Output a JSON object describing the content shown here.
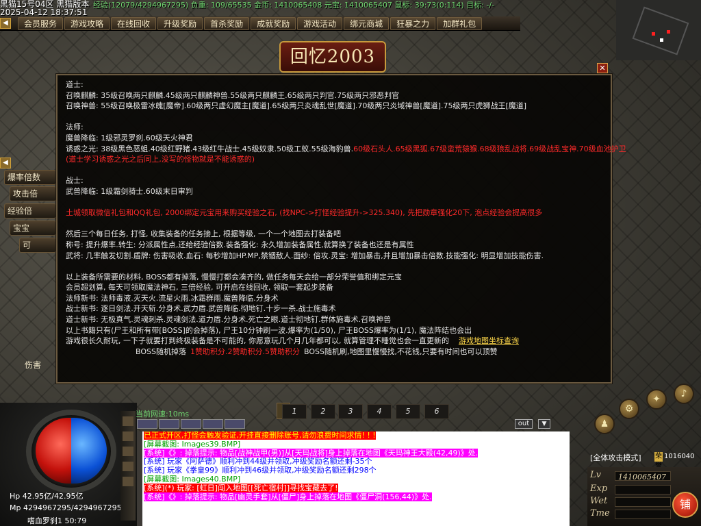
{
  "title_bar": {
    "line1": "黑猫15号04区 黑猫版本",
    "line2": "2025-04-12 18:37:51",
    "status": "经验(12079/4294967295) 负重: 109/65535 金币: 1410065408 元宝: 1410065407 鼠标: 39:73(0:114) 目标: -/-"
  },
  "menu": [
    "会员服务",
    "游戏攻略",
    "在线回收",
    "升级奖励",
    "首杀奖励",
    "成就奖励",
    "游戏活动",
    "绑元商城",
    "狂暴之力",
    "加群礼包"
  ],
  "banner": "回忆2003",
  "side_buttons": [
    "爆率倍数",
    "攻击倍",
    "经验倍",
    "宝宝",
    "可",
    "伤害"
  ],
  "panel_lines": [
    {
      "t": "道士:"
    },
    {
      "t": "召唤麒麟:  35级召唤两只麒麟.45级两只麒麟神兽.55级两只麒麟王.65级两只判官.75级两只邪恶判官"
    },
    {
      "t": "召唤神兽:  55级召唤极雷冰魄[魔帝].60级两只虚幻魔主[魔道].65级两只炎魂乱世[魔道].70级两只炎域神兽[魔道].75级两只虎狮战王[魔道]"
    },
    {
      "t": ""
    },
    {
      "t": "法师:"
    },
    {
      "t": "魔兽降临: 1级邪灵罗刹.60级天火神君"
    },
    {
      "t": "诱惑之光: 38级黑色恶蛆.40级红野猪.43级红牛战士.45级奴隶.50级工蚁.55级海豹兽.",
      "r": "60级石头人.65级黑狐.67级蛮荒猿猴.68级狼乱战将.69级战乱宝神.70级血池护卫"
    },
    {
      "t": "",
      "r": "(道士学习诱惑之光之后同上,没写的怪物就是不能诱惑的)"
    },
    {
      "t": ""
    },
    {
      "t": "战士:"
    },
    {
      "t": "武兽降临: 1级霜剑骑士.60级末日审判"
    },
    {
      "t": ""
    },
    {
      "t": "",
      "r": "土城领取微信礼包和QQ礼包, 2000绑定元宝用来购买经验之石, (找NPC->打怪经验提升->325.340), 先把勋章强化20下, 泡点经验会提高很多"
    },
    {
      "t": ""
    },
    {
      "t": "然后三个每日任务, 打怪, 收集装备的任务接上, 根据等级, 一个一个地图去打装备吧"
    },
    {
      "t": "称号: 提升爆率.转生: 分派属性点,还给经验倍数.装备强化: 永久增加装备属性,就算换了装备也还是有属性"
    },
    {
      "t": "武将: 几率触发切割.盾牌: 伤害吸收.血石: 每秒增加HP.MP,禁锢敌人.面纱: 倍攻.灵宝: 增加暴击,并且增加暴击倍数.技能强化: 明显增加技能伤害."
    },
    {
      "t": ""
    },
    {
      "t": "以上装备所需要的材料, BOSS都有掉落, 慢慢打都会凑齐的, 做任务每天会给一部分荣誉值和绑定元宝"
    },
    {
      "t": "会员超划算, 每天可领取魔法神石, 三倍经验, 可开启在线回收, 领取一套起步装备"
    },
    {
      "t": "法师新书: 法师毒液.灭天火.流星火雨.冰霜群雨.魔兽降临.分身术"
    },
    {
      "t": "战士新书: 逐日剑法.开天斩.分身术.武力盾.武兽降临.彻地钉.十步一杀.战士施毒术"
    },
    {
      "t": "道士新书: 无极真气.灵魂刺杀.灵魂剑法.道力盾.分身术.死亡之眼.道士彻地钉.群体施毒术.召唤神兽"
    },
    {
      "t": "以上书籍只有(尸王和所有带[BOSS]的会掉落), 尸王10分钟刷一波.爆率为(1/50), 尸王BOSS爆率为(1/1), 魔法阵结也会出"
    },
    {
      "t": "游戏很长久耐玩, 一下子就要打到终极装备是不可能的, 你愿意玩几个月几年都可以, 就算管理不睡觉也会一直更新的",
      "link": "游戏地图坐标查询"
    }
  ],
  "panel_last": {
    "a": "BOSS随机掉落",
    "b": "1赞助积分.2赞助积分.5赞助积分",
    "c": "BOSS随机刷,地图里慢慢找,不花钱,只要有时间也可以顶赞"
  },
  "net_speed": "当前网速:10ms",
  "skill_slots": [
    "1",
    "2",
    "3",
    "4",
    "5",
    "6"
  ],
  "chat_buttons": [
    "out"
  ],
  "chat": [
    {
      "t": "已正式开区,打怪会触发验证,开挂直接删除账号,请勿浪费时间求情! ! !",
      "bg": "#ff0000",
      "c": "#ffff00"
    },
    {
      "t": "[屏幕截图: Images39.BMP]",
      "bg": "",
      "c": "#00a000"
    },
    {
      "t": "[系统]《》: 掉落提示: 物品[战神战甲(男)]从[天玛战将]身上掉落在地图《天玛神王大殿(42,49)》处.",
      "bg": "#ff00ff",
      "c": "#ffffff"
    },
    {
      "t": "[系统] 玩家《阿萨德》顺利冲到44级并领取,冲级奖励名额还剩-35个",
      "bg": "",
      "c": "#0000ff"
    },
    {
      "t": "[系统] 玩家《拳皇99》顺利冲到46级并领取,冲级奖励名额还剩298个",
      "bg": "",
      "c": "#0000ff"
    },
    {
      "t": "[屏幕截图: Images40.BMP]",
      "bg": "",
      "c": "#00a000"
    },
    {
      "t": "[系统](*) 玩家: [虹日]闯入地图[[死亡宿村]]寻找宝藏去了!",
      "bg": "#ff0000",
      "c": "#ffffff"
    },
    {
      "t": "[系统]《》: 掉落提示: 物品[幽灵手套]从[僵尸]身上掉落在地图《僵尸洞(156,44)》处.",
      "bg": "#ff00ff",
      "c": "#ffffff"
    }
  ],
  "attack_mode": "[全体攻击模式]",
  "shop_label": "荣誉",
  "shop_value": "1016040",
  "stats": {
    "lv_label": "Lv",
    "lv_value": "1410065407",
    "exp_label": "Exp",
    "wet_label": "Wet",
    "time_label": "Tme",
    "hp": "Hp 42.95亿/42.95亿",
    "mp": "Mp 4294967295/4294967295",
    "location": "嗜血罗刹1 50:79"
  },
  "shop_button": "铺",
  "colors": {
    "accent": "#c79a3c",
    "hp": "#c4120c",
    "mp": "#0b51d6"
  }
}
